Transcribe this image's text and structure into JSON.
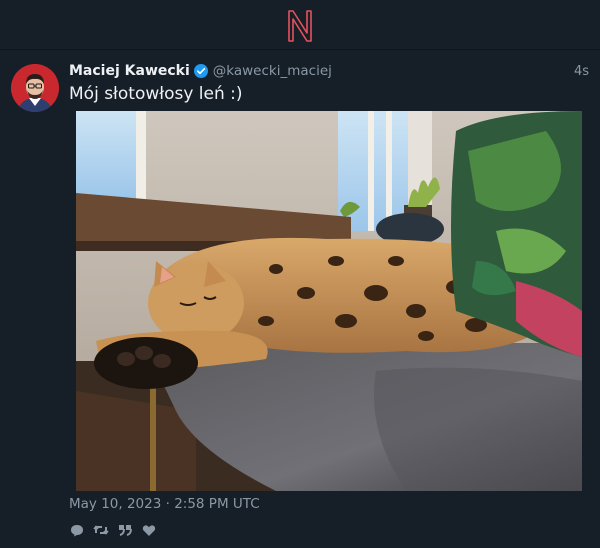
{
  "app": {
    "logo_letter": "N",
    "brand_color": "#e4525d"
  },
  "tweet": {
    "fullname": "Maciej Kawecki",
    "username": "@kawecki_maciej",
    "time": "4s",
    "text": "Mój słotowłosy leń :)",
    "date": "May 10, 2023 · 2:58 PM UTC",
    "verified_icon": "verified-badge-icon",
    "verified_color": "#1d9bf0",
    "image": "photo of a spotted cat sleeping on a chair in sunlight",
    "actions": [
      {
        "name": "comment-icon"
      },
      {
        "name": "retweet-icon"
      },
      {
        "name": "quote-icon"
      },
      {
        "name": "heart-icon"
      }
    ]
  }
}
